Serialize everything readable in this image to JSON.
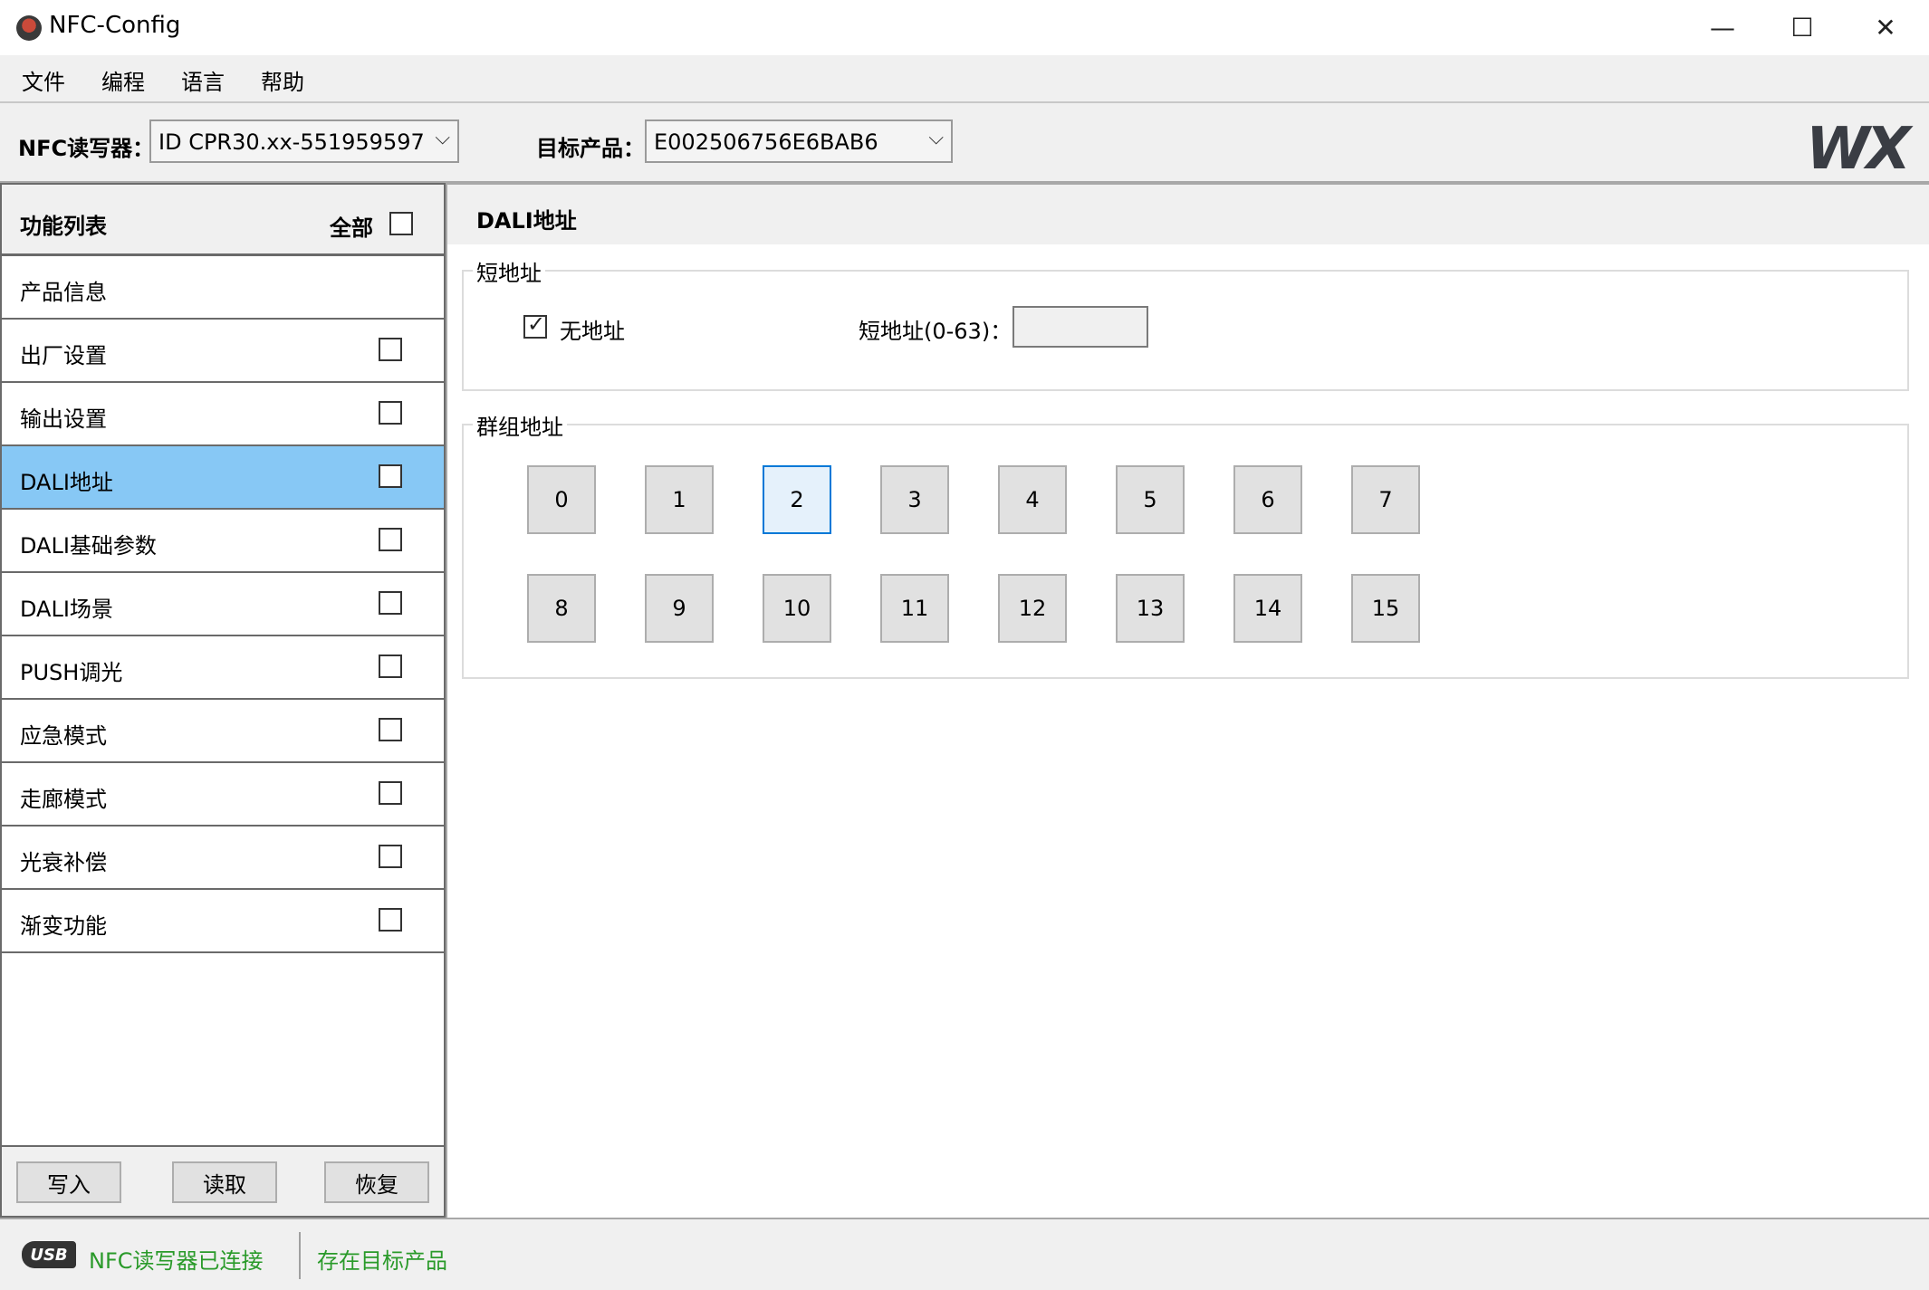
{
  "window": {
    "title": "NFC-Config",
    "controls": {
      "minimize": "—",
      "maximize": "☐",
      "close": "✕"
    }
  },
  "menu": [
    "文件",
    "编程",
    "语言",
    "帮助"
  ],
  "toolbar": {
    "reader_label": "NFC读写器：",
    "reader_value": "ID CPR30.xx-551959597",
    "product_label": "目标产品：",
    "product_value": "E002506756E6BAB6",
    "logo": "WX"
  },
  "function_list": {
    "title": "功能列表",
    "all_label": "全部",
    "items": [
      {
        "label": "产品信息",
        "has_checkbox": false
      },
      {
        "label": "出厂设置",
        "has_checkbox": true
      },
      {
        "label": "输出设置",
        "has_checkbox": true
      },
      {
        "label": "DALI地址",
        "has_checkbox": true,
        "active": true
      },
      {
        "label": "DALI基础参数",
        "has_checkbox": true
      },
      {
        "label": "DALI场景",
        "has_checkbox": true
      },
      {
        "label": "PUSH调光",
        "has_checkbox": true
      },
      {
        "label": "应急模式",
        "has_checkbox": true
      },
      {
        "label": "走廊模式",
        "has_checkbox": true
      },
      {
        "label": "光衰补偿",
        "has_checkbox": true
      },
      {
        "label": "渐变功能",
        "has_checkbox": true
      }
    ],
    "buttons": [
      "写入",
      "读取",
      "恢复"
    ]
  },
  "content": {
    "title": "DALI地址",
    "short_address": {
      "legend": "短地址",
      "no_address_label": "无地址",
      "no_address_checked": true,
      "range_label": "短地址(0-63)：",
      "value": ""
    },
    "group_address": {
      "legend": "群组地址",
      "groups": [
        "0",
        "1",
        "2",
        "3",
        "4",
        "5",
        "6",
        "7",
        "8",
        "9",
        "10",
        "11",
        "12",
        "13",
        "14",
        "15"
      ],
      "selected": "2"
    }
  },
  "status": {
    "usb_icon": "USB",
    "reader_status": "NFC读写器已连接",
    "product_status": "存在目标产品"
  }
}
